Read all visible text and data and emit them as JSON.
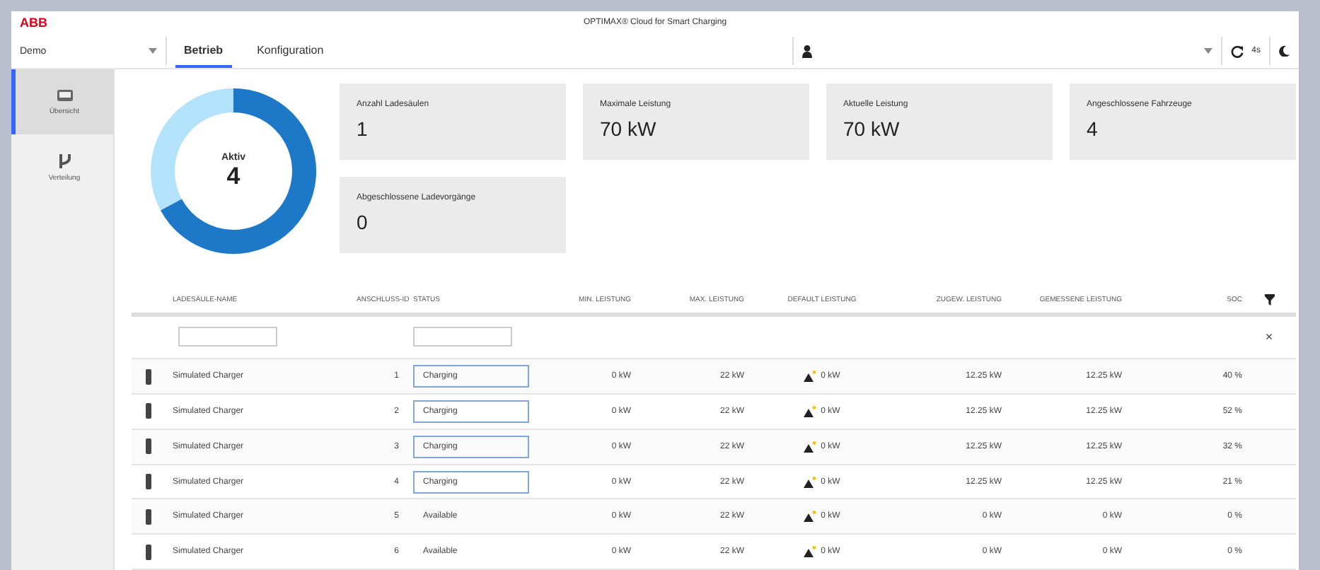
{
  "header": {
    "logo": "ABB",
    "title": "OPTIMAX® Cloud for Smart Charging",
    "site": "Demo",
    "refresh_interval": "4s"
  },
  "tabs": [
    {
      "label": "Betrieb",
      "selected": true
    },
    {
      "label": "Konfiguration",
      "selected": false
    }
  ],
  "sidebar": {
    "items": [
      {
        "label": "Übersicht",
        "selected": true
      },
      {
        "label": "Verteilung",
        "selected": false
      }
    ]
  },
  "donut": {
    "label": "Aktiv",
    "value": "4",
    "level": 0.67
  },
  "cards": [
    {
      "label": "Anzahl Ladesäulen",
      "value": "1"
    },
    {
      "label": "Maximale Leistung",
      "value": "70 kW"
    },
    {
      "label": "Aktuelle Leistung",
      "value": "70 kW"
    },
    {
      "label": "Angeschlossene Fahrzeuge",
      "value": "4"
    },
    {
      "label": "Abgeschlossene Ladevorgänge",
      "value": "0"
    }
  ],
  "table": {
    "columns": [
      "LADESÄULE-NAME",
      "ANSCHLUSS-ID",
      "STATUS",
      "MIN. LEISTUNG",
      "MAX. LEISTUNG",
      "DEFAULT LEISTUNG",
      "ZUGEW. LEISTUNG",
      "GEMESSENE LEISTUNG",
      "SOC"
    ],
    "rows": [
      {
        "name": "Simulated Charger",
        "id": "1",
        "status": "Charging",
        "status_boxed": true,
        "min": "0 kW",
        "max": "22 kW",
        "default": "0 kW",
        "assigned": "12.25 kW",
        "measured": "12.25 kW",
        "soc": "40 %"
      },
      {
        "name": "Simulated Charger",
        "id": "2",
        "status": "Charging",
        "status_boxed": true,
        "min": "0 kW",
        "max": "22 kW",
        "default": "0 kW",
        "assigned": "12.25 kW",
        "measured": "12.25 kW",
        "soc": "52 %"
      },
      {
        "name": "Simulated Charger",
        "id": "3",
        "status": "Charging",
        "status_boxed": true,
        "min": "0 kW",
        "max": "22 kW",
        "default": "0 kW",
        "assigned": "12.25 kW",
        "measured": "12.25 kW",
        "soc": "32 %"
      },
      {
        "name": "Simulated Charger",
        "id": "4",
        "status": "Charging",
        "status_boxed": true,
        "min": "0 kW",
        "max": "22 kW",
        "default": "0 kW",
        "assigned": "12.25 kW",
        "measured": "12.25 kW",
        "soc": "21 %"
      },
      {
        "name": "Simulated Charger",
        "id": "5",
        "status": "Available",
        "status_boxed": false,
        "min": "0 kW",
        "max": "22 kW",
        "default": "0 kW",
        "assigned": "0 kW",
        "measured": "0 kW",
        "soc": "0 %"
      },
      {
        "name": "Simulated Charger",
        "id": "6",
        "status": "Available",
        "status_boxed": false,
        "min": "0 kW",
        "max": "22 kW",
        "default": "0 kW",
        "assigned": "0 kW",
        "measured": "0 kW",
        "soc": "0 %"
      }
    ],
    "clear_filter": "×"
  }
}
